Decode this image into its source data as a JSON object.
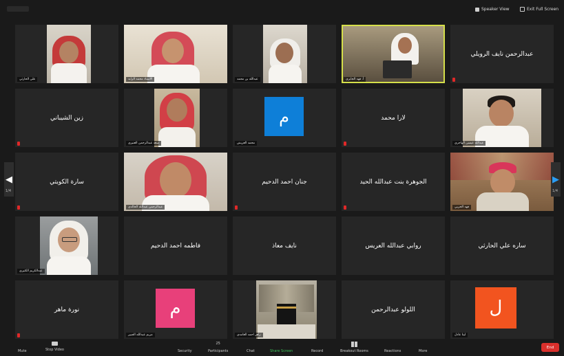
{
  "topbar": {
    "speaker_view": "Speaker View",
    "exit_full_screen": "Exit Full Screen"
  },
  "nav": {
    "left_page": "1/4",
    "right_page": "1/4"
  },
  "tiles": [
    {
      "label": "علي الحارثي"
    },
    {
      "label": "الأستاذ محمد الزايد"
    },
    {
      "label": "عبدالله بن محمد"
    },
    {
      "label": "أ. فهد الجابري"
    },
    {
      "name": "عبدالرحمن نايف الرويلي"
    },
    {
      "name": "زين الشيباني"
    },
    {
      "label": "سعد عبدالرحمن العنيزي"
    },
    {
      "label": "محمد العريش",
      "avatar": "م"
    },
    {
      "name": "لارا محمد"
    },
    {
      "label": "عبدالله عيسى الهاجري"
    },
    {
      "name": "سارة الكويتي"
    },
    {
      "label": "عبدالرحمن عبدالله الخالدي"
    },
    {
      "name": "جنان احمد الدحيم"
    },
    {
      "name": "الجوهرة بنت عبدالله الحيد"
    },
    {
      "label": "فهد الحربي"
    },
    {
      "label": "عبدالكريم الكثيري"
    },
    {
      "name": "فاطمه احمد الدحيم"
    },
    {
      "name": "نايف معاذ"
    },
    {
      "name": "روابي عبدالله العريس"
    },
    {
      "name": "ساره علي الحارثي"
    },
    {
      "name": "نورة ماهر"
    },
    {
      "label": "مريم عبدالله الجبير",
      "avatar": "م"
    },
    {
      "label": "زاهر احمد الغامدي"
    },
    {
      "name": "اللولو عبدالرحمن"
    },
    {
      "label": "لينا عادل",
      "avatar": "ل"
    }
  ],
  "toolbar": {
    "mute": "Mute",
    "stop_video": "Stop Video",
    "security": "Security",
    "participants": "Participants",
    "participants_count": "25",
    "chat": "Chat",
    "share_screen": "Share Screen",
    "record": "Record",
    "breakout_rooms": "Breakout Rooms",
    "reactions": "Reactions",
    "more": "More",
    "end": "End"
  },
  "colors": {
    "active_border": "#d6e04a",
    "share_screen_green": "#3ec15a",
    "avatar_blue": "#0e7fd8",
    "avatar_pink": "#e8407a",
    "avatar_orange": "#f2541f",
    "end_red": "#d9302c"
  }
}
